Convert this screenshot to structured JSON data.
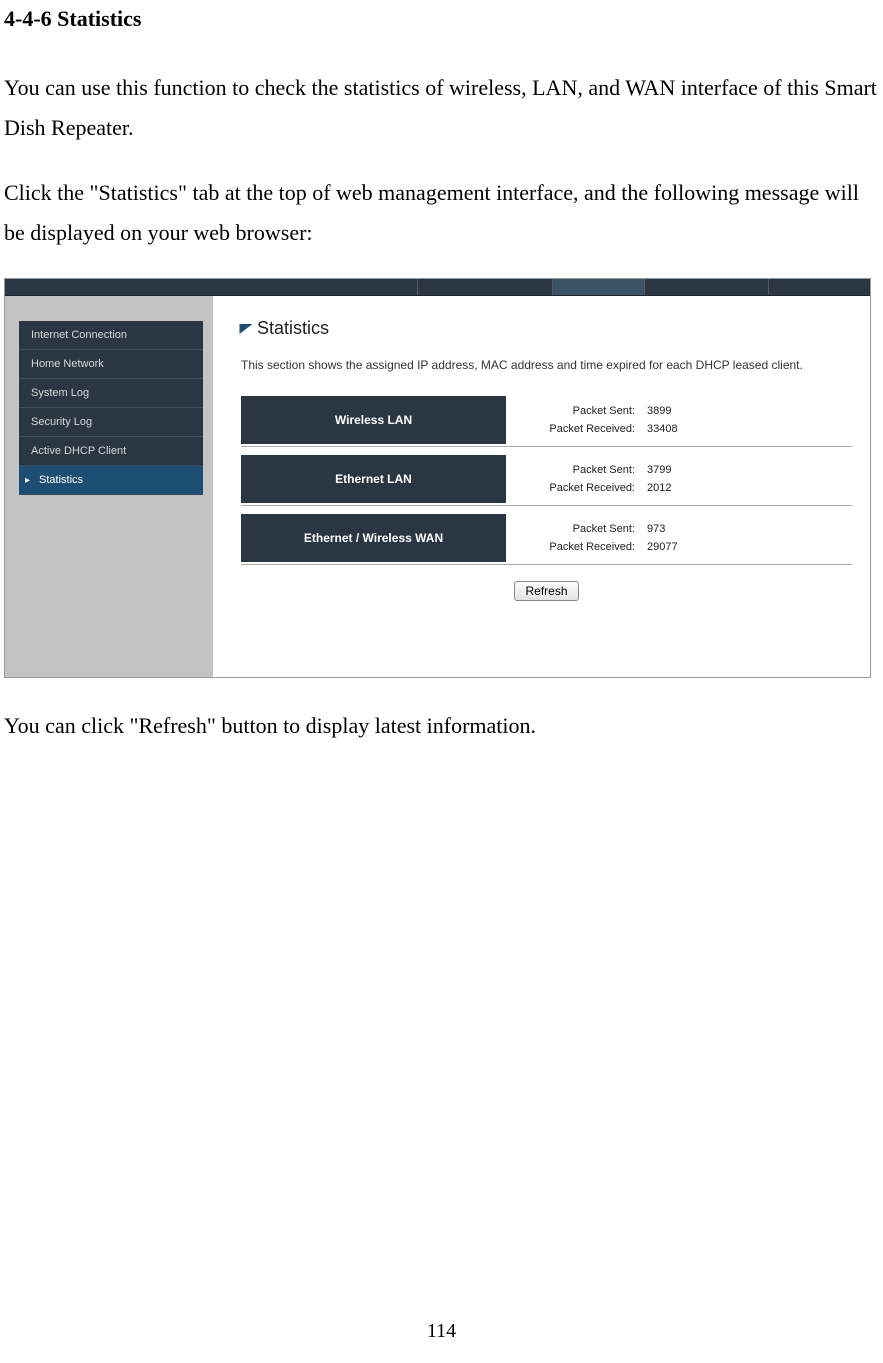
{
  "doc": {
    "heading": "4-4-6 Statistics",
    "para1": "You can use this function to check the statistics of wireless, LAN, and WAN interface of this Smart Dish Repeater.",
    "para2": "Click the \"Statistics\" tab at the top of web management interface, and the following message will be displayed on your web browser:",
    "para3": "You can click \"Refresh\" button to display latest information.",
    "page_number": "114"
  },
  "sidebar": {
    "items": [
      {
        "label": "Internet Connection",
        "active": false
      },
      {
        "label": "Home Network",
        "active": false
      },
      {
        "label": "System Log",
        "active": false
      },
      {
        "label": "Security Log",
        "active": false
      },
      {
        "label": "Active DHCP Client",
        "active": false
      },
      {
        "label": "Statistics",
        "active": true
      }
    ]
  },
  "panel": {
    "title": "Statistics",
    "desc": "This section shows the assigned IP address, MAC address and time expired for each DHCP leased client.",
    "rows": [
      {
        "name": "Wireless LAN",
        "sent_label": "Packet Sent:",
        "sent": "3899",
        "recv_label": "Packet Received:",
        "recv": "33408"
      },
      {
        "name": "Ethernet LAN",
        "sent_label": "Packet Sent:",
        "sent": "3799",
        "recv_label": "Packet Received:",
        "recv": "2012"
      },
      {
        "name": "Ethernet / Wireless WAN",
        "sent_label": "Packet Sent:",
        "sent": "973",
        "recv_label": "Packet Received:",
        "recv": "29077"
      }
    ],
    "refresh_label": "Refresh"
  }
}
